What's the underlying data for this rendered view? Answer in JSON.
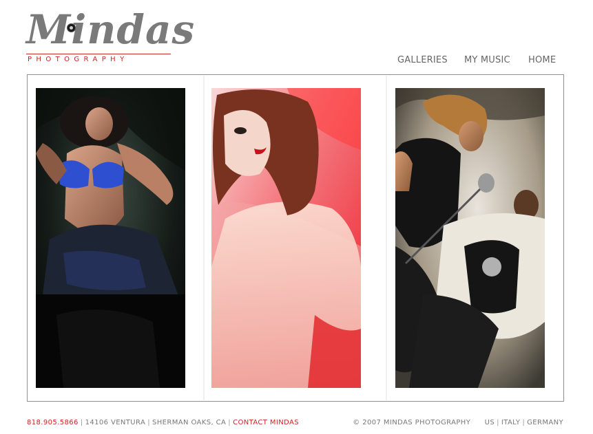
{
  "header": {
    "logo": {
      "wordmark": "Mindas",
      "subtitle": "PHOTOGRAPHY"
    },
    "nav": [
      {
        "label": "GALLERIES"
      },
      {
        "label": "MY MUSIC"
      },
      {
        "label": "HOME"
      }
    ]
  },
  "gallery": {
    "photos": [
      {
        "subject": "woman in blue bikini reclining on dark fabric"
      },
      {
        "subject": "red-haired woman portrait on red and pink background"
      },
      {
        "subject": "couple dancing with vintage microphone"
      }
    ]
  },
  "footer": {
    "phone": "818.905.5866",
    "address": "14106 VENTURA",
    "city": "SHERMAN OAKS, CA",
    "contact_link": "CONTACT MINDAS",
    "copyright": "© 2007 MINDAS PHOTOGRAPHY",
    "regions": [
      "US",
      "ITALY",
      "GERMANY"
    ]
  },
  "colors": {
    "accent": "#cc2222",
    "text": "#666666",
    "frame_border": "#8f8f8f"
  }
}
